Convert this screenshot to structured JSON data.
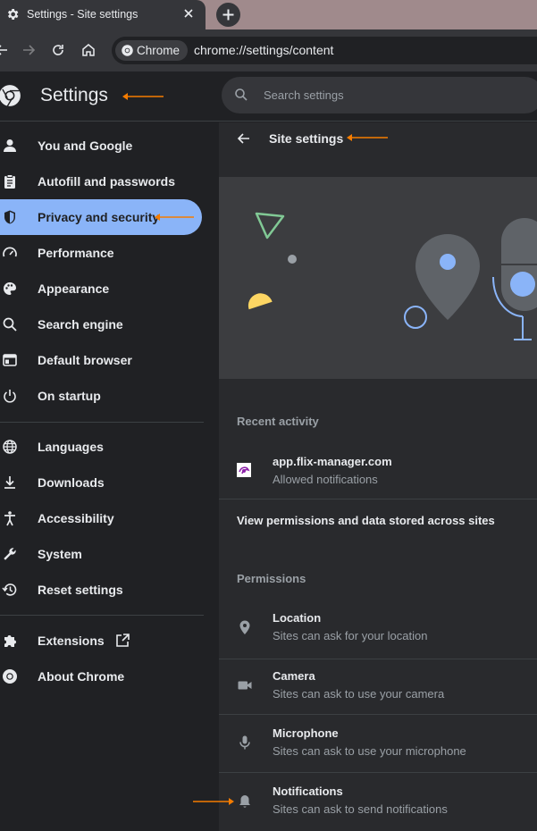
{
  "tab": {
    "title": "Settings - Site settings"
  },
  "toolbar": {
    "chip_label": "Chrome",
    "url": "chrome://settings/content"
  },
  "header": {
    "title": "Settings",
    "search_placeholder": "Search settings"
  },
  "sidebar": {
    "items": [
      {
        "label": "You and Google",
        "icon": "person-icon"
      },
      {
        "label": "Autofill and passwords",
        "icon": "clipboard-icon"
      },
      {
        "label": "Privacy and security",
        "icon": "shield-icon",
        "active": true
      },
      {
        "label": "Performance",
        "icon": "speedometer-icon"
      },
      {
        "label": "Appearance",
        "icon": "palette-icon"
      },
      {
        "label": "Search engine",
        "icon": "search-icon"
      },
      {
        "label": "Default browser",
        "icon": "browser-icon"
      },
      {
        "label": "On startup",
        "icon": "power-icon"
      },
      {
        "label": "Languages",
        "icon": "globe-icon"
      },
      {
        "label": "Downloads",
        "icon": "download-icon"
      },
      {
        "label": "Accessibility",
        "icon": "accessibility-icon"
      },
      {
        "label": "System",
        "icon": "wrench-icon"
      },
      {
        "label": "Reset settings",
        "icon": "history-icon"
      },
      {
        "label": "Extensions",
        "icon": "puzzle-icon"
      },
      {
        "label": "About Chrome",
        "icon": "chrome-icon"
      }
    ]
  },
  "main": {
    "title": "Site settings",
    "recent_label": "Recent activity",
    "recent": {
      "site": "app.flix-manager.com",
      "detail": "Allowed notifications"
    },
    "view_all": "View permissions and data stored across sites",
    "permissions_label": "Permissions",
    "permissions": [
      {
        "title": "Location",
        "sub": "Sites can ask for your location",
        "icon": "location-pin-icon"
      },
      {
        "title": "Camera",
        "sub": "Sites can ask to use your camera",
        "icon": "camera-icon"
      },
      {
        "title": "Microphone",
        "sub": "Sites can ask to use your microphone",
        "icon": "microphone-icon"
      },
      {
        "title": "Notifications",
        "sub": "Sites can ask to send notifications",
        "icon": "bell-icon"
      }
    ]
  },
  "colors": {
    "accent": "#8ab4f8",
    "annotation": "#f57c00"
  }
}
